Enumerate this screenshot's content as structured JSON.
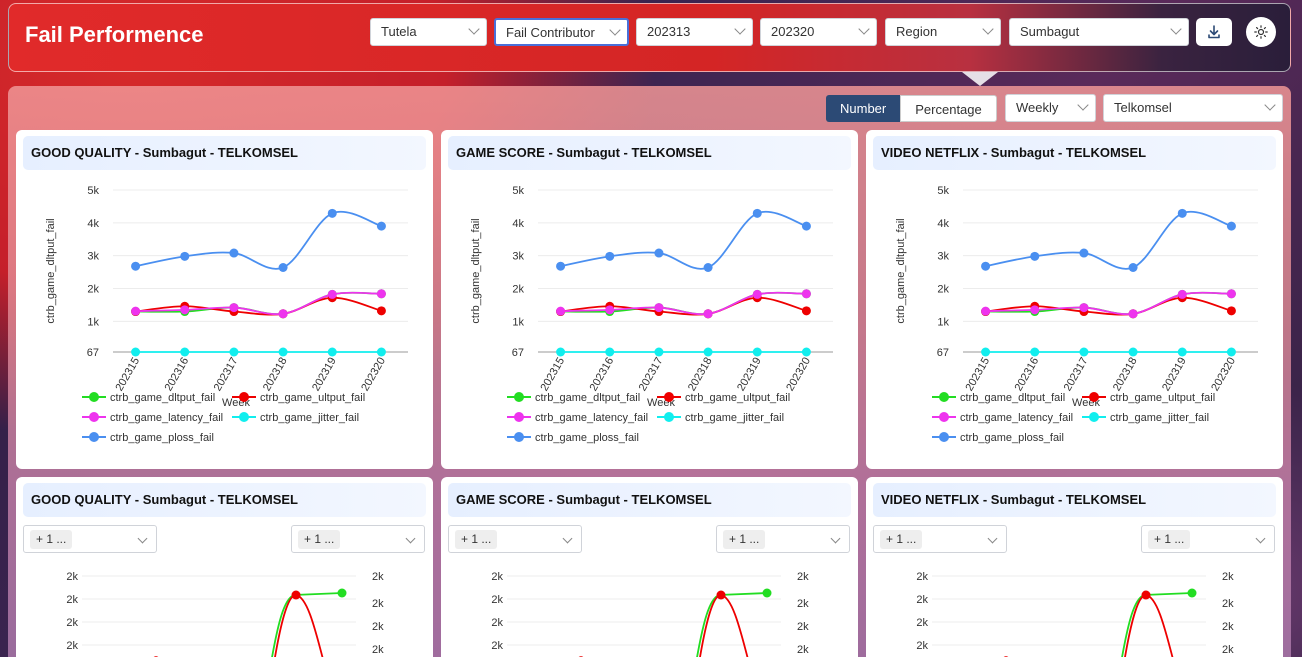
{
  "header": {
    "title": "Fail Performence",
    "filters": [
      "Tutela",
      "Fail Contributor",
      "202313",
      "202320",
      "Region",
      "Sumbagut"
    ],
    "download_icon": "download-icon",
    "theme_icon": "sun-icon"
  },
  "toolbar": {
    "number_label": "Number",
    "percentage_label": "Percentage",
    "period": "Weekly",
    "operator": "Telkomsel"
  },
  "cards_top": [
    {
      "title": "GOOD QUALITY - Sumbagut - TELKOMSEL"
    },
    {
      "title": "GAME SCORE - Sumbagut - TELKOMSEL"
    },
    {
      "title": "VIDEO NETFLIX - Sumbagut - TELKOMSEL"
    }
  ],
  "cards_bottom": [
    {
      "title": "GOOD QUALITY - Sumbagut - TELKOMSEL",
      "left_tag": "+ 1 ...",
      "right_tag": "+ 1 ..."
    },
    {
      "title": "GAME SCORE - Sumbagut - TELKOMSEL",
      "left_tag": "+ 1 ...",
      "right_tag": "+ 1 ..."
    },
    {
      "title": "VIDEO NETFLIX - Sumbagut - TELKOMSEL",
      "left_tag": "+ 1 ...",
      "right_tag": "+ 1 ..."
    }
  ],
  "chart_data": [
    {
      "type": "line",
      "title": "",
      "xlabel": "Week",
      "ylabel": "ctrb_game_dltput_fail",
      "categories": [
        "202315",
        "202316",
        "202317",
        "202318",
        "202319",
        "202320"
      ],
      "y_ticks": [
        "67",
        "1k",
        "2k",
        "3k",
        "4k",
        "5k"
      ],
      "ylim": [
        67,
        5000
      ],
      "series": [
        {
          "name": "ctrb_game_dltput_fail",
          "color": "#22dd22",
          "values": [
            1300,
            1300,
            1420,
            1230,
            1820,
            1840
          ]
        },
        {
          "name": "ctrb_game_ultput_fail",
          "color": "#ee0000",
          "values": [
            1300,
            1460,
            1300,
            1230,
            1720,
            1320
          ]
        },
        {
          "name": "ctrb_game_latency_fail",
          "color": "#ee33ee",
          "values": [
            1310,
            1350,
            1420,
            1230,
            1820,
            1840
          ]
        },
        {
          "name": "ctrb_game_jitter_fail",
          "color": "#11eeee",
          "values": [
            67,
            67,
            67,
            67,
            67,
            67
          ]
        },
        {
          "name": "ctrb_game_ploss_fail",
          "color": "#4a8ff0",
          "values": [
            2680,
            2980,
            3080,
            2640,
            4290,
            3900
          ]
        }
      ],
      "legend": "bottom",
      "grid": true
    },
    {
      "type": "line",
      "y_ticks": [
        "2k",
        "2k",
        "2k",
        "2k"
      ],
      "right_y_ticks": [
        "2k",
        "2k",
        "2k",
        "2k"
      ],
      "series": [
        {
          "name": "",
          "color": "#22dd22"
        },
        {
          "name": "",
          "color": "#ee0000"
        }
      ]
    }
  ]
}
